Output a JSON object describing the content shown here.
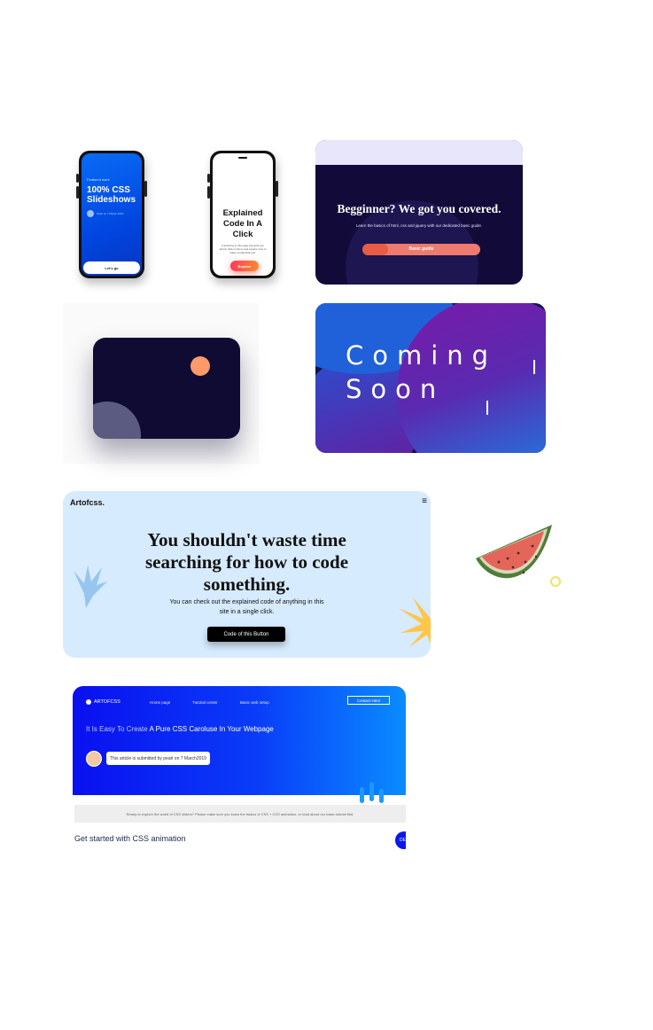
{
  "phone1": {
    "featured": "Featured work",
    "title": "100% CSS Slideshows",
    "meta": "Pearl on 7 March 2019",
    "button": "Let's go"
  },
  "phone2": {
    "title": "Explained Code In A Click",
    "description": "If anything in this page interests you simply click on them and explore how to make an identical one.",
    "button": "Explore"
  },
  "beginner": {
    "heading": "Begginner? We got you covered.",
    "subheading": "Learn the basics of html, css and jquery with our dedicated basic guide.",
    "button": "Basic guide",
    "progress": 0.22
  },
  "coming_soon": {
    "line1": "Coming",
    "line2": "Soon"
  },
  "hero": {
    "logo": "Artofcss.",
    "menu_icon": "≡",
    "heading": "You shouldn't waste time searching for how to code something.",
    "subheading": "You can check out the explained code of anything in this site in a single click.",
    "button": "Code of this Button"
  },
  "article": {
    "logo": "ARTOFCSS",
    "nav": [
      "Home page",
      "Tutorial center",
      "Basic web setup"
    ],
    "contact": "Contact Here",
    "title_light": "It Is Easy To Create",
    "title_bold": "A Pure CSS Caroluse In Your Webpage",
    "byline": "This article is submitted by pearl on 7 March2019",
    "banner": "Ready to explore the world of CSS sliders? Please make sure you know the basics of CSS + CSS animation, or read about our basic tutorial first.",
    "section_title": "Get started with CSS animation",
    "fab": "DE"
  },
  "colors": {
    "phone_blue": "#0a6cf5",
    "beginner_bg": "#120b3a",
    "beginner_button": "#e85c43",
    "dark_card": "#0f0b33",
    "dark_card_circle": "#ff9a6b",
    "hero_bg": "#d6ebfd",
    "article_gradient_start": "#0a10f0",
    "article_gradient_end": "#0a8cff"
  }
}
